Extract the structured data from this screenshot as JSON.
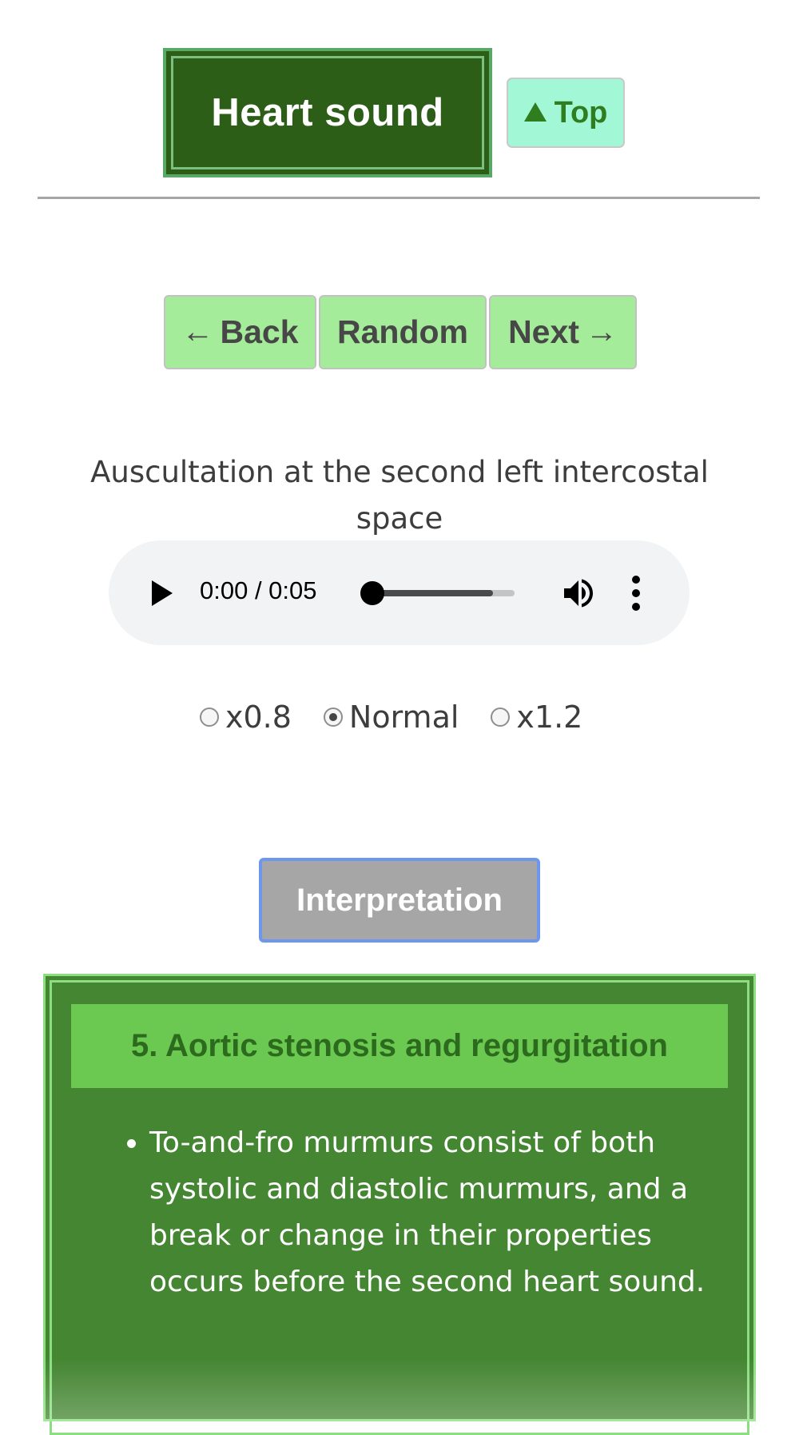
{
  "header": {
    "title": "Heart sound",
    "top_button_label": "Top",
    "top_button_icon": "triangle-up-icon"
  },
  "nav": {
    "back_label": "Back",
    "back_icon": "arrow-left-icon",
    "random_label": "Random",
    "next_label": "Next",
    "next_icon": "arrow-right-icon"
  },
  "audio": {
    "caption": "Auscultation at the second left intercostal space",
    "time_display": "0:00 / 0:05",
    "current_time": "0:00",
    "duration": "0:05",
    "playback_progress": 0,
    "buffered_fraction": 0.85,
    "controls": [
      "play-icon",
      "volume-icon",
      "more-vert-icon"
    ]
  },
  "speed": {
    "options": [
      {
        "label": "x0.8",
        "checked": false
      },
      {
        "label": "Normal",
        "checked": true
      },
      {
        "label": "x1.2",
        "checked": false
      }
    ]
  },
  "interpretation": {
    "button_label": "Interpretation",
    "heading": "5. Aortic stenosis and regurgitation",
    "items": [
      "To-and-fro murmurs consist of both systolic and diastolic murmurs, and a break or change in their properties occurs before the second heart sound."
    ]
  },
  "colors": {
    "title_bg": "#2c5e17",
    "top_button_bg": "#a2f7d6",
    "nav_button_bg": "#a5ec9a",
    "interp_button_bg": "#a6a6a6",
    "interp_button_focus": "#6d96ef",
    "panel_bg": "#458633",
    "panel_head_bg": "#6bc851",
    "panel_head_text": "#2c6a1d"
  }
}
